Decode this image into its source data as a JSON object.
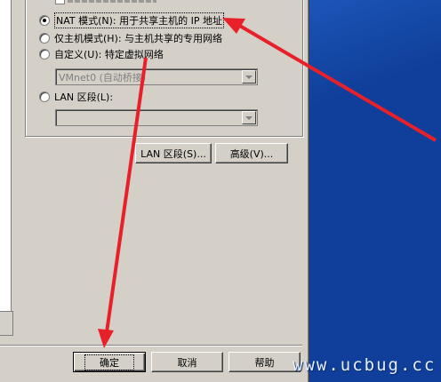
{
  "network": {
    "options": [
      {
        "label": "NAT 模式(N): 用于共享主机的 IP 地址",
        "selected": true
      },
      {
        "label": "仅主机模式(H): 与主机共享的专用网络",
        "selected": false
      },
      {
        "label": "自定义(U): 特定虚拟网络",
        "selected": false
      },
      {
        "label": "LAN 区段(L):",
        "selected": false
      }
    ],
    "custom_select_value": "VMnet0 (自动桥接)",
    "lan_select_value": ""
  },
  "buttons": {
    "lan_segments": "LAN 区段(S)...",
    "advanced": "高级(V)...",
    "ok": "确定",
    "cancel": "取消",
    "help": "帮助"
  },
  "watermark": "www.ucbug.cc",
  "annotation_color": "#e8202a"
}
